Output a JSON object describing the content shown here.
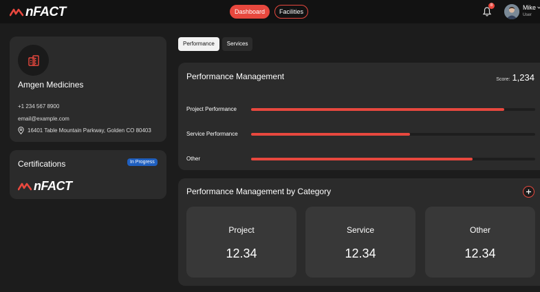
{
  "brand": {
    "name": "nFACT",
    "accent": "#e8483e"
  },
  "nav": {
    "dashboard_label": "Dashboard",
    "facilities_label": "Facilities"
  },
  "notifications": {
    "count": "8"
  },
  "user": {
    "name": "Mike",
    "role": "User"
  },
  "company": {
    "name": "Amgen Medicines",
    "phone": "+1 234 567 8900",
    "email": "email@example.com",
    "address": "16401 Table Mountain Parkway, Golden CO 80403",
    "icon": "building-icon"
  },
  "certifications": {
    "title": "Certifications",
    "status": "In Progress",
    "logo_text": "nFACT"
  },
  "tabs": [
    {
      "label": "Performance",
      "active": true
    },
    {
      "label": "Services",
      "active": false
    }
  ],
  "performance": {
    "title": "Performance Management",
    "score_label": "Score:",
    "score_value": "1,234",
    "rows": [
      {
        "label": "Project Performance",
        "fraction": 0.89
      },
      {
        "label": "Service Performance",
        "fraction": 0.56
      },
      {
        "label": "Other",
        "fraction": 0.78
      }
    ]
  },
  "categories": {
    "title": "Performance Management by Category",
    "items": [
      {
        "label": "Project",
        "value": "12.34"
      },
      {
        "label": "Service",
        "value": "12.34"
      },
      {
        "label": "Other",
        "value": "12.34"
      }
    ]
  }
}
